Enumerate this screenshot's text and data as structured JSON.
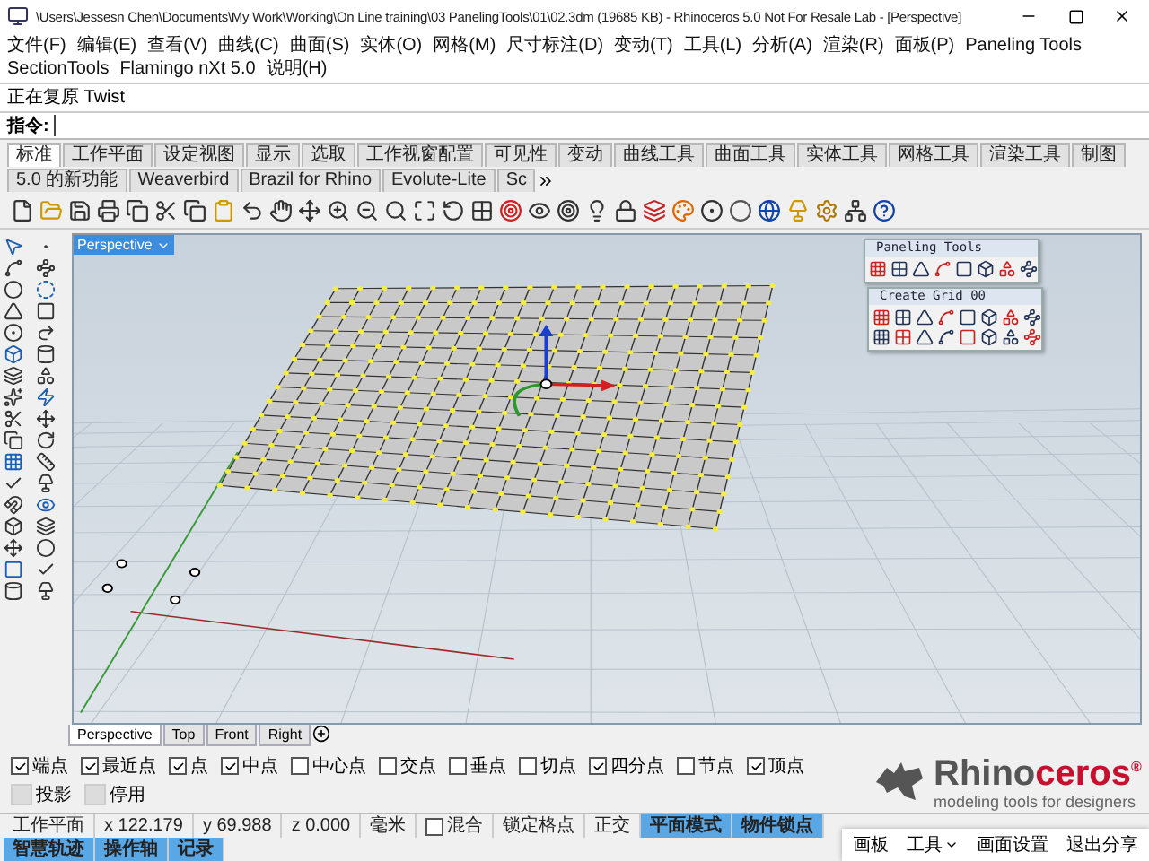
{
  "window": {
    "title": "\\Users\\Jessesn Chen\\Documents\\My Work\\Working\\On Line training\\03 PanelingTools\\01\\02.3dm (19685 KB) - Rhinoceros 5.0 Not For Resale Lab - [Perspective]"
  },
  "menu": [
    "文件(F)",
    "编辑(E)",
    "查看(V)",
    "曲线(C)",
    "曲面(S)",
    "实体(O)",
    "网格(M)",
    "尺寸标注(D)",
    "变动(T)",
    "工具(L)",
    "分析(A)",
    "渲染(R)",
    "面板(P)",
    "Paneling Tools",
    "SectionTools",
    "Flamingo nXt 5.0",
    "说明(H)"
  ],
  "command_history": "正在复原 Twist",
  "command_prompt": "指令:",
  "toolbar_tabs": [
    {
      "label": "标准",
      "selected": true
    },
    {
      "label": "工作平面",
      "selected": false
    },
    {
      "label": "设定视图",
      "selected": false
    },
    {
      "label": "显示",
      "selected": false
    },
    {
      "label": "选取",
      "selected": false
    },
    {
      "label": "工作视窗配置",
      "selected": false
    },
    {
      "label": "可见性",
      "selected": false
    },
    {
      "label": "变动",
      "selected": false
    },
    {
      "label": "曲线工具",
      "selected": false
    },
    {
      "label": "曲面工具",
      "selected": false
    },
    {
      "label": "实体工具",
      "selected": false
    },
    {
      "label": "网格工具",
      "selected": false
    },
    {
      "label": "渲染工具",
      "selected": false
    },
    {
      "label": "制图",
      "selected": false
    },
    {
      "label": "5.0 的新功能",
      "selected": false
    },
    {
      "label": "Weaverbird",
      "selected": false
    },
    {
      "label": "Brazil for Rhino",
      "selected": false
    },
    {
      "label": "Evolute-Lite",
      "selected": false
    },
    {
      "label": "Sc",
      "selected": false
    }
  ],
  "viewport": {
    "label": "Perspective"
  },
  "floating_toolbars": [
    {
      "title": "Paneling Tools"
    },
    {
      "title": "Create Grid 00"
    }
  ],
  "viewport_tabs": [
    {
      "label": "Perspective",
      "selected": true
    },
    {
      "label": "Top",
      "selected": false
    },
    {
      "label": "Front",
      "selected": false
    },
    {
      "label": "Right",
      "selected": false
    }
  ],
  "osnaps": [
    {
      "kind": "check",
      "label": "端点",
      "checked": true
    },
    {
      "kind": "check",
      "label": "最近点",
      "checked": true
    },
    {
      "kind": "check",
      "label": "点",
      "checked": true
    },
    {
      "kind": "check",
      "label": "中点",
      "checked": true
    },
    {
      "kind": "check",
      "label": "中心点",
      "checked": false
    },
    {
      "kind": "check",
      "label": "交点",
      "checked": false
    },
    {
      "kind": "check",
      "label": "垂点",
      "checked": false
    },
    {
      "kind": "check",
      "label": "切点",
      "checked": false
    },
    {
      "kind": "check",
      "label": "四分点",
      "checked": true
    },
    {
      "kind": "check",
      "label": "节点",
      "checked": false
    },
    {
      "kind": "check",
      "label": "顶点",
      "checked": true
    },
    {
      "kind": "toggle",
      "label": "投影",
      "on": false
    },
    {
      "kind": "toggle",
      "label": "停用",
      "on": false
    }
  ],
  "logo": {
    "wordmark": [
      "Rhino",
      "ceros",
      "®"
    ],
    "tagline": "modeling tools for designers"
  },
  "status_bar": [
    {
      "kind": "label",
      "text": "工作平面"
    },
    {
      "kind": "label",
      "text": "x 122.179"
    },
    {
      "kind": "label",
      "text": "y 69.988"
    },
    {
      "kind": "label",
      "text": "z 0.000"
    },
    {
      "kind": "label",
      "text": "毫米"
    },
    {
      "kind": "check",
      "text": "混合",
      "checked": false
    },
    {
      "kind": "toggle",
      "text": "锁定格点",
      "on": false
    },
    {
      "kind": "toggle",
      "text": "正交",
      "on": false
    },
    {
      "kind": "toggle",
      "text": "平面模式",
      "on": true
    },
    {
      "kind": "toggle",
      "text": "物件锁点",
      "on": true
    },
    {
      "kind": "toggle",
      "text": "智慧轨迹",
      "on": true
    },
    {
      "kind": "toggle",
      "text": "操作轴",
      "on": true
    },
    {
      "kind": "toggle",
      "text": "记录",
      "on": true
    }
  ],
  "share_bar": [
    {
      "label": "画板",
      "menu": false
    },
    {
      "label": "工具",
      "menu": true
    },
    {
      "label": "画面设置",
      "menu": false
    },
    {
      "label": "退出分享",
      "menu": false
    }
  ]
}
